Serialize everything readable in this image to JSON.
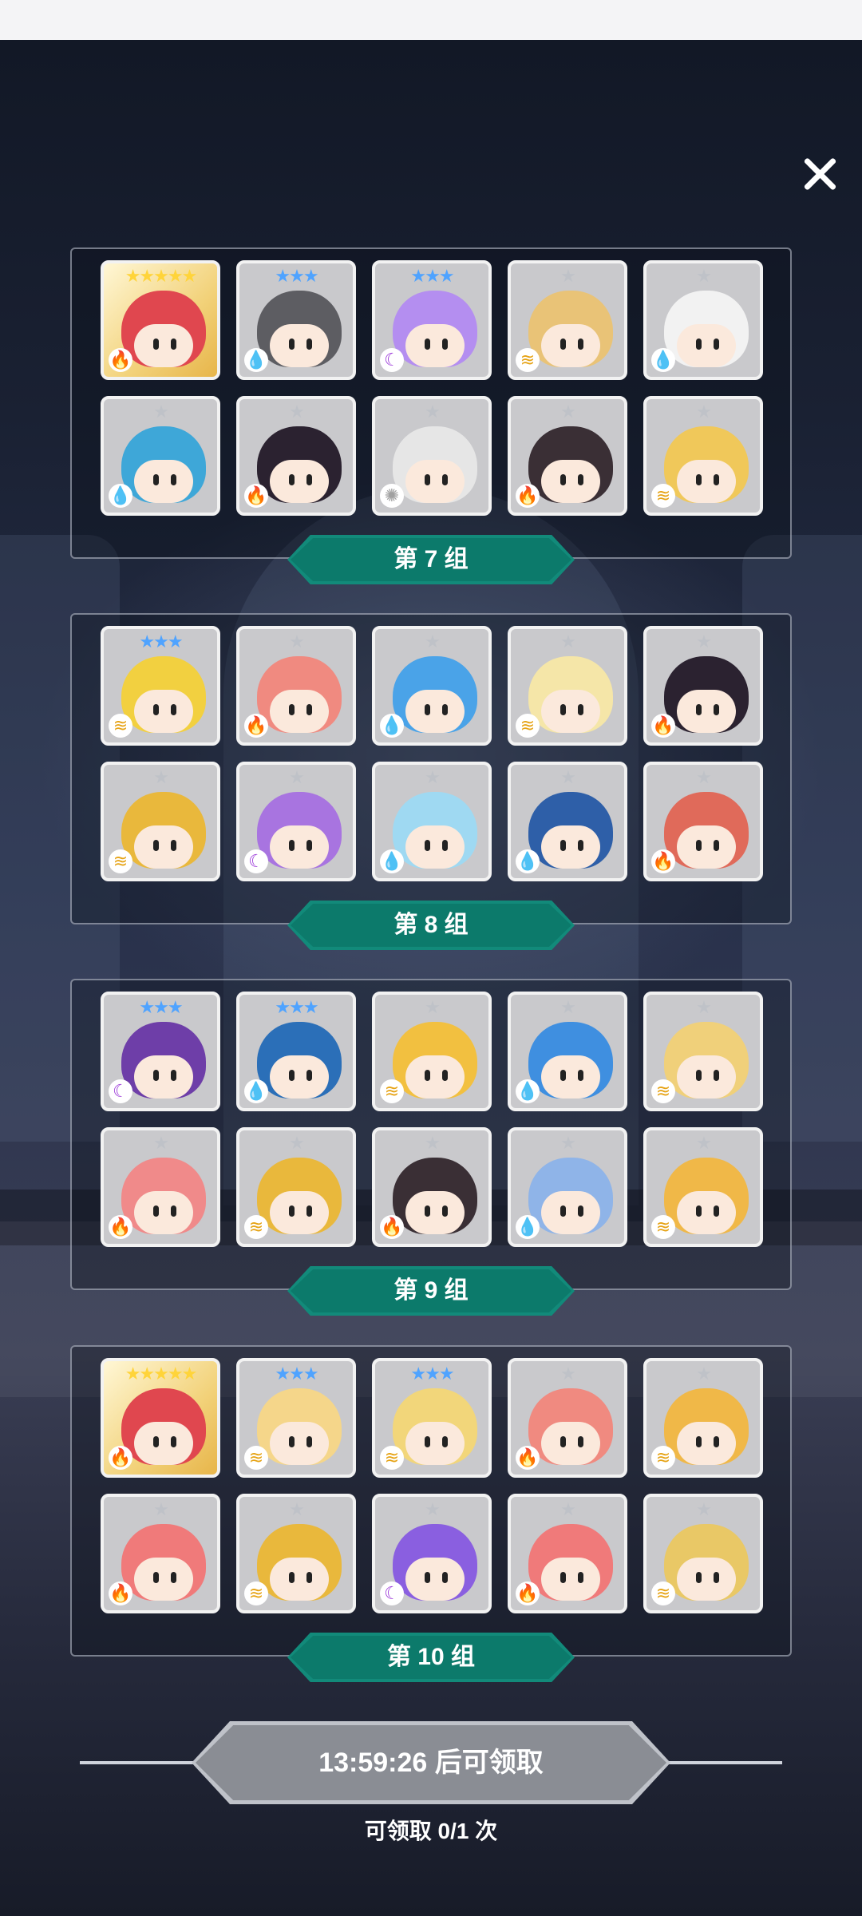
{
  "groups": [
    {
      "label": "第 7 组",
      "cards": [
        {
          "stars": "★★★★★",
          "rarity": "s5",
          "element": "fire",
          "elem_icon": "🔥",
          "hair": "#e0474f",
          "gold": true
        },
        {
          "stars": "★★★",
          "rarity": "s3",
          "element": "water",
          "elem_icon": "💧",
          "hair": "#5d5d62"
        },
        {
          "stars": "★★★",
          "rarity": "s3",
          "element": "moon",
          "elem_icon": "☾",
          "hair": "#b48ef0"
        },
        {
          "stars": "★",
          "rarity": "s1",
          "element": "wind",
          "elem_icon": "≋",
          "hair": "#e9c377"
        },
        {
          "stars": "★",
          "rarity": "s1",
          "element": "water",
          "elem_icon": "💧",
          "hair": "#f2f2f2"
        },
        {
          "stars": "★",
          "rarity": "s1",
          "element": "water",
          "elem_icon": "💧",
          "hair": "#3ea7d8"
        },
        {
          "stars": "★",
          "rarity": "s1",
          "element": "fire",
          "elem_icon": "🔥",
          "hair": "#2b2230"
        },
        {
          "stars": "★",
          "rarity": "s1",
          "element": "light",
          "elem_icon": "✺",
          "hair": "#e6e6e6"
        },
        {
          "stars": "★",
          "rarity": "s1",
          "element": "fire",
          "elem_icon": "🔥",
          "hair": "#3a2f35"
        },
        {
          "stars": "★",
          "rarity": "s1",
          "element": "wind",
          "elem_icon": "≋",
          "hair": "#f0c85a"
        }
      ]
    },
    {
      "label": "第 8 组",
      "cards": [
        {
          "stars": "★★★",
          "rarity": "s3",
          "element": "wind",
          "elem_icon": "≋",
          "hair": "#f2d040"
        },
        {
          "stars": "★",
          "rarity": "s1",
          "element": "fire",
          "elem_icon": "🔥",
          "hair": "#f08a80"
        },
        {
          "stars": "★",
          "rarity": "s1",
          "element": "water",
          "elem_icon": "💧",
          "hair": "#4aa3e8"
        },
        {
          "stars": "★",
          "rarity": "s1",
          "element": "wind",
          "elem_icon": "≋",
          "hair": "#f5e6a8"
        },
        {
          "stars": "★",
          "rarity": "s1",
          "element": "fire",
          "elem_icon": "🔥",
          "hair": "#2b2230"
        },
        {
          "stars": "★",
          "rarity": "s1",
          "element": "wind",
          "elem_icon": "≋",
          "hair": "#e9b83c"
        },
        {
          "stars": "★",
          "rarity": "s1",
          "element": "moon",
          "elem_icon": "☾",
          "hair": "#a874e0"
        },
        {
          "stars": "★",
          "rarity": "s1",
          "element": "water",
          "elem_icon": "💧",
          "hair": "#9fd9f2"
        },
        {
          "stars": "★",
          "rarity": "s1",
          "element": "water",
          "elem_icon": "💧",
          "hair": "#2e5fa8"
        },
        {
          "stars": "★",
          "rarity": "s1",
          "element": "fire",
          "elem_icon": "🔥",
          "hair": "#e06a5a"
        }
      ]
    },
    {
      "label": "第 9 组",
      "cards": [
        {
          "stars": "★★★",
          "rarity": "s3",
          "element": "moon",
          "elem_icon": "☾",
          "hair": "#6e3ea8"
        },
        {
          "stars": "★★★",
          "rarity": "s3",
          "element": "water",
          "elem_icon": "💧",
          "hair": "#2b6fb8"
        },
        {
          "stars": "★",
          "rarity": "s1",
          "element": "wind",
          "elem_icon": "≋",
          "hair": "#f2c040"
        },
        {
          "stars": "★",
          "rarity": "s1",
          "element": "water",
          "elem_icon": "💧",
          "hair": "#3f8fe0"
        },
        {
          "stars": "★",
          "rarity": "s1",
          "element": "wind",
          "elem_icon": "≋",
          "hair": "#f0d07a"
        },
        {
          "stars": "★",
          "rarity": "s1",
          "element": "fire",
          "elem_icon": "🔥",
          "hair": "#f08a8a"
        },
        {
          "stars": "★",
          "rarity": "s1",
          "element": "wind",
          "elem_icon": "≋",
          "hair": "#e9b83c"
        },
        {
          "stars": "★",
          "rarity": "s1",
          "element": "fire",
          "elem_icon": "🔥",
          "hair": "#3a2f35"
        },
        {
          "stars": "★",
          "rarity": "s1",
          "element": "water",
          "elem_icon": "💧",
          "hair": "#8fb4e8"
        },
        {
          "stars": "★",
          "rarity": "s1",
          "element": "wind",
          "elem_icon": "≋",
          "hair": "#f0b848"
        }
      ]
    },
    {
      "label": "第 10 组",
      "cards": [
        {
          "stars": "★★★★★",
          "rarity": "s5",
          "element": "fire",
          "elem_icon": "🔥",
          "hair": "#e0474f",
          "gold": true
        },
        {
          "stars": "★★★",
          "rarity": "s3",
          "element": "wind",
          "elem_icon": "≋",
          "hair": "#f5d68a"
        },
        {
          "stars": "★★★",
          "rarity": "s3",
          "element": "wind",
          "elem_icon": "≋",
          "hair": "#f2d67a"
        },
        {
          "stars": "★",
          "rarity": "s1",
          "element": "fire",
          "elem_icon": "🔥",
          "hair": "#f08a80"
        },
        {
          "stars": "★",
          "rarity": "s1",
          "element": "wind",
          "elem_icon": "≋",
          "hair": "#f0b848"
        },
        {
          "stars": "★",
          "rarity": "s1",
          "element": "fire",
          "elem_icon": "🔥",
          "hair": "#f07a7a"
        },
        {
          "stars": "★",
          "rarity": "s1",
          "element": "wind",
          "elem_icon": "≋",
          "hair": "#e9b83c"
        },
        {
          "stars": "★",
          "rarity": "s1",
          "element": "moon",
          "elem_icon": "☾",
          "hair": "#8a5fe0"
        },
        {
          "stars": "★",
          "rarity": "s1",
          "element": "fire",
          "elem_icon": "🔥",
          "hair": "#f07a7a"
        },
        {
          "stars": "★",
          "rarity": "s1",
          "element": "wind",
          "elem_icon": "≋",
          "hair": "#e9c866"
        }
      ]
    }
  ],
  "claim": {
    "label": "13:59:26 后可领取",
    "count": "可领取 0/1 次"
  },
  "colors": {
    "tag": "#0c7a6b",
    "claim_disabled": "#8a8d94"
  }
}
